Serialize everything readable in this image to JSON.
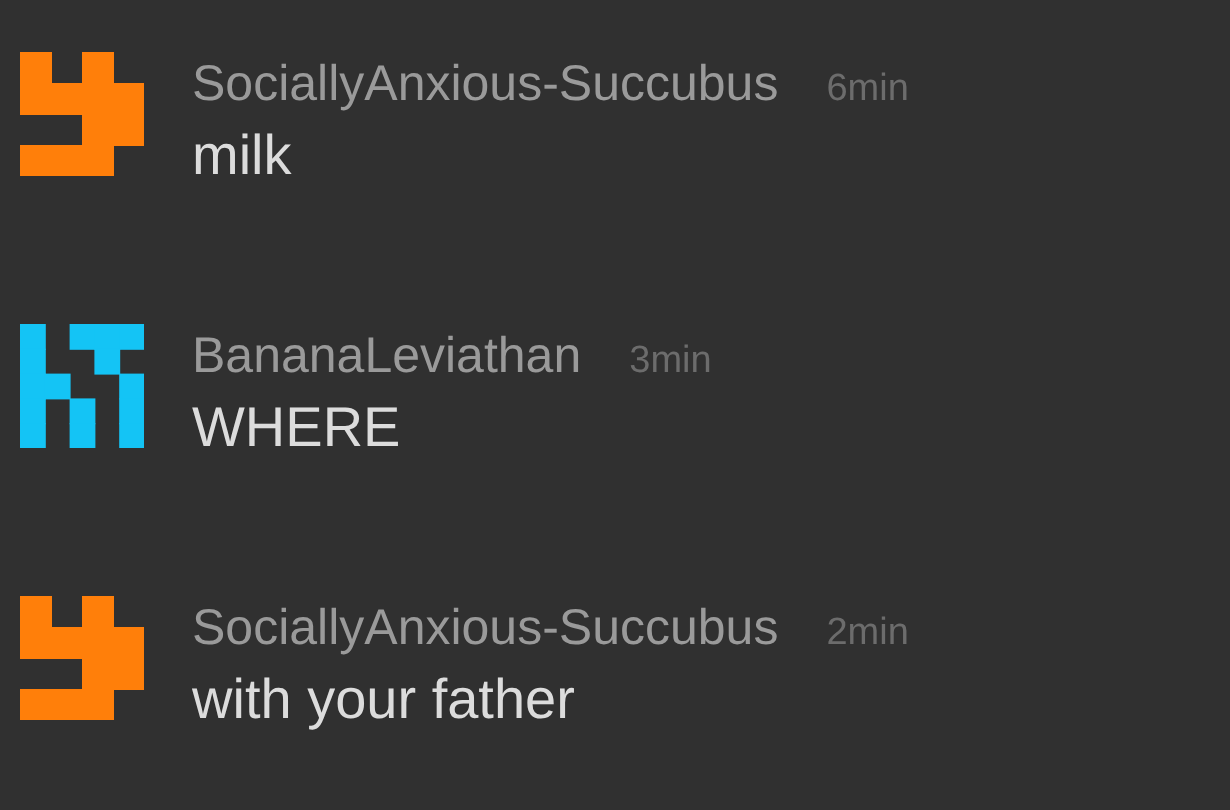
{
  "messages": [
    {
      "author": "SociallyAnxious-Succubus",
      "time": "6min",
      "text": "milk",
      "avatar": {
        "kind": "hook",
        "color": "#ff7f0a"
      }
    },
    {
      "author": "BananaLeviathan",
      "time": "3min",
      "text": "WHERE",
      "avatar": {
        "kind": "checker",
        "color": "#14c4f5"
      }
    },
    {
      "author": "SociallyAnxious-Succubus",
      "time": "2min",
      "text": "with your father",
      "avatar": {
        "kind": "hook",
        "color": "#ff7f0a"
      }
    }
  ]
}
